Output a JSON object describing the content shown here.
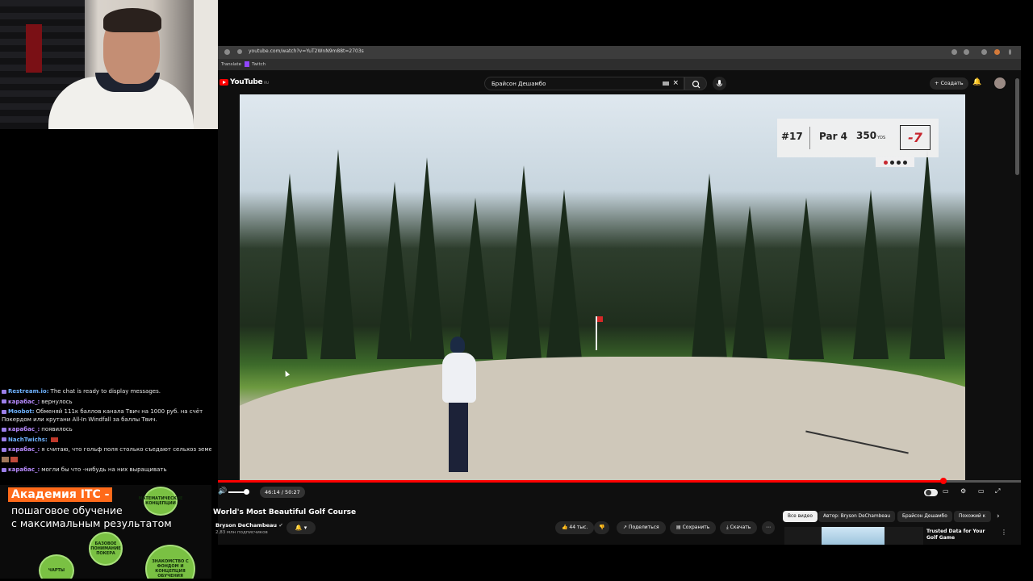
{
  "browser": {
    "url": "youtube.com/watch?v=YuT2WnN9m88t=2703s",
    "bookmarks": [
      "Translate",
      "Twitch"
    ]
  },
  "youtube": {
    "logo_text": "YouTube",
    "logo_region": "RU",
    "search_value": "Брайсон Дешамбо",
    "create_label": "Создать"
  },
  "video": {
    "scorebug": {
      "hole": "#17",
      "par": "Par 4",
      "yards": "350",
      "yards_unit": "YDS",
      "score": "-7"
    },
    "time": "46:14 / 50:27",
    "progress": 0.97,
    "volume": 0.8
  },
  "below": {
    "title": "World's Most Beautiful Golf Course",
    "channel_name": "Bryson DeChambeau",
    "subscribers": "2,83 млн подписчиков",
    "likes": "44 тыс.",
    "share_label": "Поделиться",
    "save_label": "Сохранить",
    "download_label": "Скачать",
    "chips": [
      "Все видео",
      "Автор: Bryson DeChambeau",
      "Брайсон Дешамбо",
      "Похожий к"
    ],
    "recommended_title": "Trusted Data for Your Golf Game"
  },
  "chat": {
    "messages": [
      {
        "user": "Restream.io:",
        "text": "The chat is ready to display messages."
      },
      {
        "user": "карабас_:",
        "text": "вернулось"
      },
      {
        "user": "Moobot:",
        "text": "Обменяй 111к баллов канала Твич на 1000 руб. на счёт Покердом или крутани All-In Windfall за баллы Твич."
      },
      {
        "user": "карабас_:",
        "text": "появилось"
      },
      {
        "user": "NachTwichs:",
        "text": ""
      },
      {
        "user": "карабас_:",
        "text": "я считаю, что гольф поля столько съедают сельхоз земель"
      },
      {
        "user": "карабас_:",
        "text": "могли бы что -нибудь на них выращивать"
      }
    ]
  },
  "ad": {
    "headline": "Академия ITC -",
    "subtitle_line1": "пошаговое обучение",
    "subtitle_line2": "с максимальным результатом",
    "nodes": [
      "МАТЕМАТИЧЕСКИЕ КОНЦЕПЦИИ",
      "БАЗОВОЕ ПОНИМАНИЕ ПОКЕРА",
      "ЧАРТЫ",
      "ЗНАКОМСТВО С ФОНДОМ И КОНЦЕПЦИЯ ОБУЧЕНИЯ"
    ]
  },
  "colors": {
    "yt_red": "#ff0000",
    "ad_orange": "#ff6a1a",
    "ad_green": "#7ac143",
    "score_red": "#c6262e"
  }
}
